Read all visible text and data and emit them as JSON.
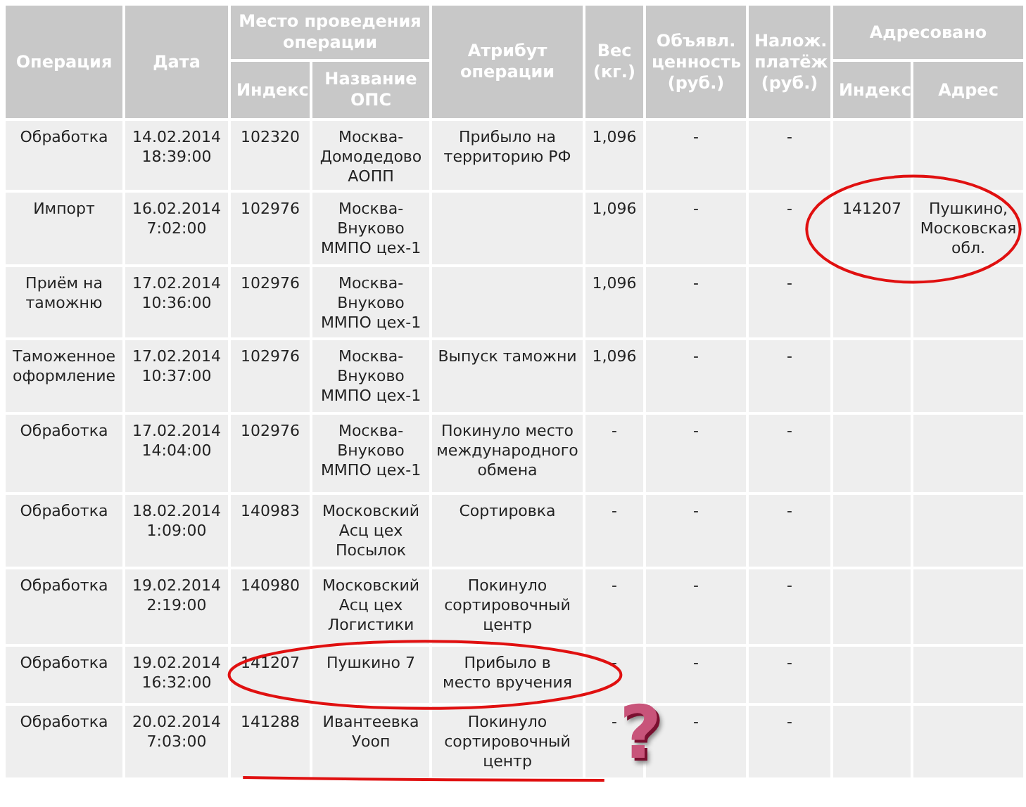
{
  "table": {
    "header": {
      "operation": "Операция",
      "date": "Дата",
      "place": "Место проведения операции",
      "index": "Индекс",
      "office": "Название ОПС",
      "attribute": "Атрибут операции",
      "weight": "Вес (кг.)",
      "declared_value": "Объявл. ценность (руб.)",
      "cod": "Налож. платёж (руб.)",
      "addressed": "Адресовано",
      "addr_index": "Индекс",
      "address": "Адрес"
    },
    "rows": [
      {
        "operation": "Обработка",
        "date": "14.02.2014\n18:39:00",
        "index": "102320",
        "office": "Москва-\nДомодедово\nАОПП",
        "attribute": "Прибыло на\nтерриторию РФ",
        "weight": "1,096",
        "declared_value": "-",
        "cod": "-"
      },
      {
        "operation": "Импорт",
        "date": "16.02.2014\n7:02:00",
        "index": "102976",
        "office": "Москва-\nВнуково\nММПО цех-1",
        "weight": "1,096",
        "declared_value": "-",
        "cod": "-",
        "addr_index": "141207",
        "address": "Пушкино,\nМосковская\nобл."
      },
      {
        "operation": "Приём на\nтаможню",
        "date": "17.02.2014\n10:36:00",
        "index": "102976",
        "office": "Москва-\nВнуково\nММПО цех-1",
        "weight": "1,096",
        "declared_value": "-",
        "cod": "-"
      },
      {
        "operation": "Таможенное\nоформление",
        "date": "17.02.2014\n10:37:00",
        "index": "102976",
        "office": "Москва-\nВнуково\nММПО цех-1",
        "attribute": "Выпуск таможни",
        "weight": "1,096",
        "declared_value": "-",
        "cod": "-"
      },
      {
        "operation": "Обработка",
        "date": "17.02.2014\n14:04:00",
        "index": "102976",
        "office": "Москва-\nВнуково\nММПО цех-1",
        "attribute": "Покинуло место\nмеждународного\nобмена",
        "weight": "-",
        "declared_value": "-",
        "cod": "-"
      },
      {
        "operation": "Обработка",
        "date": "18.02.2014\n1:09:00",
        "index": "140983",
        "office": "Московский\nАсц цех\nПосылок",
        "attribute": "Сортировка",
        "weight": "-",
        "declared_value": "-",
        "cod": "-"
      },
      {
        "operation": "Обработка",
        "date": "19.02.2014\n2:19:00",
        "index": "140980",
        "office": "Московский\nАсц цех\nЛогистики",
        "attribute": "Покинуло\nсортировочный\nцентр",
        "weight": "-",
        "declared_value": "-",
        "cod": "-"
      },
      {
        "operation": "Обработка",
        "date": "19.02.2014\n16:32:00",
        "index": "141207",
        "office": "Пушкино 7",
        "attribute": "Прибыло в\nместо вручения",
        "weight": "-",
        "declared_value": "-",
        "cod": "-"
      },
      {
        "operation": "Обработка",
        "date": "20.02.2014\n7:03:00",
        "index": "141288",
        "office": "Ивантеевка\nУооп",
        "attribute": "Покинуло\nсортировочный\nцентр",
        "weight": "-",
        "declared_value": "-",
        "cod": "-"
      }
    ]
  },
  "annotations": [
    {
      "kind": "ellipse"
    },
    {
      "kind": "ellipse"
    },
    {
      "kind": "underline"
    },
    {
      "kind": "question",
      "text": "?"
    }
  ]
}
